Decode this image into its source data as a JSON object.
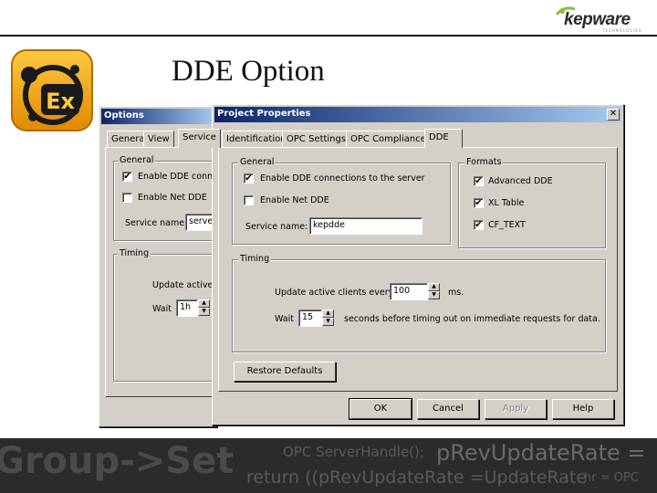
{
  "slide": {
    "title": "DDE Option",
    "brand": "kepware",
    "brand_sub": "TECHNOLOGIES",
    "footer_code": [
      "Group->Set",
      "OPC ServerHandle();",
      "pRevUpdateRate =",
      "return ((pRevUpdateRate =UpdateRate",
      "hr = OPC"
    ]
  },
  "options_dialog": {
    "title": "Options",
    "tabs": [
      "General",
      "View",
      "Service"
    ],
    "general_group": "General",
    "enable_dde": "Enable DDE conne",
    "enable_net_dde": "Enable Net DDE",
    "service_name_label": "Service name",
    "service_name_value": "serve",
    "timing_group": "Timing",
    "update_active": "Update active c",
    "wait_label": "Wait",
    "wait_value": "1h"
  },
  "project_properties": {
    "title": "Project Properties",
    "close_glyph": "✕",
    "tabs": [
      "Identification",
      "OPC Settings",
      "OPC Compliance",
      "DDE"
    ],
    "general_group": "General",
    "enable_dde": "Enable DDE connections to the server",
    "enable_dde_checked": true,
    "enable_net_dde": "Enable Net DDE",
    "enable_net_dde_checked": false,
    "service_name_label": "Service name:",
    "service_name_value": "kepdde",
    "formats_group": "Formats",
    "formats": [
      {
        "label": "Advanced DDE",
        "checked": true
      },
      {
        "label": "XL Table",
        "checked": true
      },
      {
        "label": "CF_TEXT",
        "checked": true
      }
    ],
    "timing_group": "Timing",
    "update_label": "Update active clients every",
    "update_value": "100",
    "update_unit": "ms.",
    "wait_label": "Wait",
    "wait_value": "15",
    "wait_suffix": "seconds before timing out on immediate requests for data.",
    "restore_defaults": "Restore Defaults",
    "ok": "OK",
    "cancel": "Cancel",
    "apply": "Apply",
    "help": "Help"
  },
  "icons": {
    "check": "✔",
    "spin_up": "▲",
    "spin_down": "▼"
  }
}
